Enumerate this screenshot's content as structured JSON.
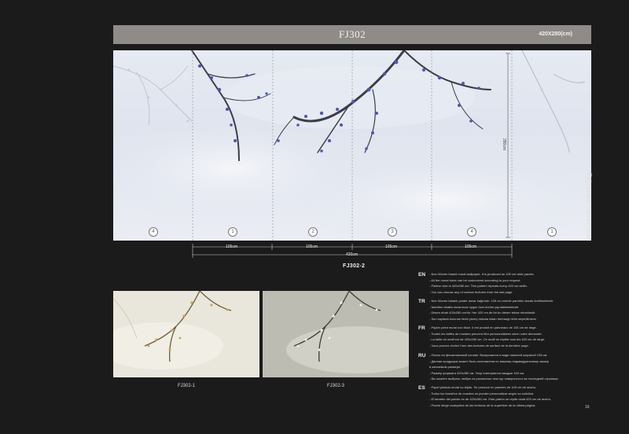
{
  "header": {
    "title": "FJ302",
    "size": "420X280(cm)"
  },
  "mural": {
    "code": "FJ302-2",
    "height_label": "280cm",
    "panel_widths": [
      "105cm",
      "105cm",
      "105cm",
      "105cm"
    ],
    "total_width": "420cm",
    "panel_numbers": [
      "4",
      "1",
      "2",
      "3",
      "4",
      "1"
    ]
  },
  "variants": [
    {
      "code": "FJ302-1"
    },
    {
      "code": "FJ302-3"
    }
  ],
  "languages": [
    {
      "code": "EN",
      "lines": [
        "- Non Woven based mural wallpaper. It is produced as 105 cm wide panels.",
        "- All the mural sizes can be customized according to your request.",
        "- Pattern size is 420x280 cm. This pattern repeats every 420 cm width.",
        "- You can choose any of surface textures from the last page."
      ]
    },
    {
      "code": "TR",
      "lines": [
        "- Non Woven tabanlı poster duvar kağıdıdır. 105 cm eninde paneller olarak üretilmektedir.",
        "- İstenilen ebatta duvarınıza uygun özel üretim yapılabilmektedir.",
        "- Desen ebatı 420x280 cm'dir. Her 420 cm de bir bu desen tekrar etmektedir.",
        "- Son sayfada bulunan farklı yüzey dokularından herhangi birini seçebilirsiniz."
      ]
    },
    {
      "code": "FR",
      "lines": [
        "- Papier peint mural non tissé. Il est produit en panneaux de 105 cm de large.",
        "- Toutes les tailles de murales peuvent être personnalisées selon votre demande.",
        "- La taille du motif est de 420x280 cm. Ce motif se répète tous les 420 cm de large.",
        "- Vous pouvez choisir l'une des textures de surface de la dernière page."
      ]
    },
    {
      "code": "RU",
      "lines": [
        "- Панно на флизелиновой основе. Выпускается в виде панелей шириной 105 см.",
        "- Данная продукция может быть изготовлена по вашему индивидуальному заказу",
        "  в желаемом размере.",
        "- Размер формата 420x280 см. Узор повторяется каждые 420 см.",
        "- Вы можете выбрать любую из различных текстур поверхности на последней странице."
      ]
    },
    {
      "code": "ES",
      "lines": [
        "- Papel pintado mural no tejido. Se produce en paneles de 105 cm de ancho.",
        "- Todos los tamaños de murales se pueden personalizar según su solicitud.",
        "- El tamaño del patrón es de 420x280 cm. Este patrón se repite cada 420 cm de ancho.",
        "- Puede elegir cualquiera de las texturas de la superficie de la última página."
      ]
    }
  ],
  "side_brand": {
    "brand": "Fyi",
    "collection": "MURAL COLLECTION"
  },
  "page_number": "16",
  "colors": {
    "background": "#1b1b1b",
    "title_bar": "#8f8b86",
    "blossom": "#4a56b8"
  }
}
